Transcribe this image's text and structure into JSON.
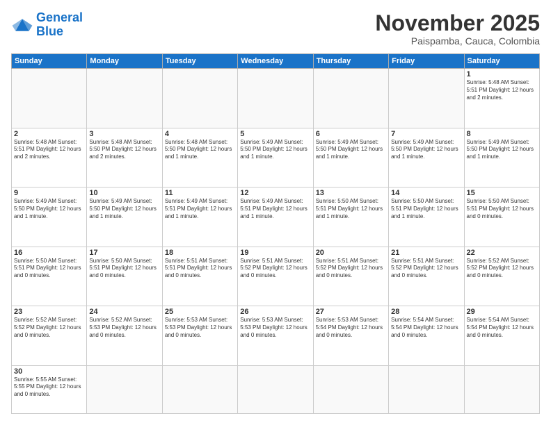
{
  "logo": {
    "line1": "General",
    "line2": "Blue"
  },
  "title": "November 2025",
  "subtitle": "Paispamba, Cauca, Colombia",
  "weekdays": [
    "Sunday",
    "Monday",
    "Tuesday",
    "Wednesday",
    "Thursday",
    "Friday",
    "Saturday"
  ],
  "weeks": [
    [
      {
        "day": "",
        "info": ""
      },
      {
        "day": "",
        "info": ""
      },
      {
        "day": "",
        "info": ""
      },
      {
        "day": "",
        "info": ""
      },
      {
        "day": "",
        "info": ""
      },
      {
        "day": "",
        "info": ""
      },
      {
        "day": "1",
        "info": "Sunrise: 5:48 AM\nSunset: 5:51 PM\nDaylight: 12 hours\nand 2 minutes."
      }
    ],
    [
      {
        "day": "2",
        "info": "Sunrise: 5:48 AM\nSunset: 5:51 PM\nDaylight: 12 hours\nand 2 minutes."
      },
      {
        "day": "3",
        "info": "Sunrise: 5:48 AM\nSunset: 5:50 PM\nDaylight: 12 hours\nand 2 minutes."
      },
      {
        "day": "4",
        "info": "Sunrise: 5:48 AM\nSunset: 5:50 PM\nDaylight: 12 hours\nand 1 minute."
      },
      {
        "day": "5",
        "info": "Sunrise: 5:49 AM\nSunset: 5:50 PM\nDaylight: 12 hours\nand 1 minute."
      },
      {
        "day": "6",
        "info": "Sunrise: 5:49 AM\nSunset: 5:50 PM\nDaylight: 12 hours\nand 1 minute."
      },
      {
        "day": "7",
        "info": "Sunrise: 5:49 AM\nSunset: 5:50 PM\nDaylight: 12 hours\nand 1 minute."
      },
      {
        "day": "8",
        "info": "Sunrise: 5:49 AM\nSunset: 5:50 PM\nDaylight: 12 hours\nand 1 minute."
      }
    ],
    [
      {
        "day": "9",
        "info": "Sunrise: 5:49 AM\nSunset: 5:50 PM\nDaylight: 12 hours\nand 1 minute."
      },
      {
        "day": "10",
        "info": "Sunrise: 5:49 AM\nSunset: 5:50 PM\nDaylight: 12 hours\nand 1 minute."
      },
      {
        "day": "11",
        "info": "Sunrise: 5:49 AM\nSunset: 5:51 PM\nDaylight: 12 hours\nand 1 minute."
      },
      {
        "day": "12",
        "info": "Sunrise: 5:49 AM\nSunset: 5:51 PM\nDaylight: 12 hours\nand 1 minute."
      },
      {
        "day": "13",
        "info": "Sunrise: 5:50 AM\nSunset: 5:51 PM\nDaylight: 12 hours\nand 1 minute."
      },
      {
        "day": "14",
        "info": "Sunrise: 5:50 AM\nSunset: 5:51 PM\nDaylight: 12 hours\nand 1 minute."
      },
      {
        "day": "15",
        "info": "Sunrise: 5:50 AM\nSunset: 5:51 PM\nDaylight: 12 hours\nand 0 minutes."
      }
    ],
    [
      {
        "day": "16",
        "info": "Sunrise: 5:50 AM\nSunset: 5:51 PM\nDaylight: 12 hours\nand 0 minutes."
      },
      {
        "day": "17",
        "info": "Sunrise: 5:50 AM\nSunset: 5:51 PM\nDaylight: 12 hours\nand 0 minutes."
      },
      {
        "day": "18",
        "info": "Sunrise: 5:51 AM\nSunset: 5:51 PM\nDaylight: 12 hours\nand 0 minutes."
      },
      {
        "day": "19",
        "info": "Sunrise: 5:51 AM\nSunset: 5:52 PM\nDaylight: 12 hours\nand 0 minutes."
      },
      {
        "day": "20",
        "info": "Sunrise: 5:51 AM\nSunset: 5:52 PM\nDaylight: 12 hours\nand 0 minutes."
      },
      {
        "day": "21",
        "info": "Sunrise: 5:51 AM\nSunset: 5:52 PM\nDaylight: 12 hours\nand 0 minutes."
      },
      {
        "day": "22",
        "info": "Sunrise: 5:52 AM\nSunset: 5:52 PM\nDaylight: 12 hours\nand 0 minutes."
      }
    ],
    [
      {
        "day": "23",
        "info": "Sunrise: 5:52 AM\nSunset: 5:52 PM\nDaylight: 12 hours\nand 0 minutes."
      },
      {
        "day": "24",
        "info": "Sunrise: 5:52 AM\nSunset: 5:53 PM\nDaylight: 12 hours\nand 0 minutes."
      },
      {
        "day": "25",
        "info": "Sunrise: 5:53 AM\nSunset: 5:53 PM\nDaylight: 12 hours\nand 0 minutes."
      },
      {
        "day": "26",
        "info": "Sunrise: 5:53 AM\nSunset: 5:53 PM\nDaylight: 12 hours\nand 0 minutes."
      },
      {
        "day": "27",
        "info": "Sunrise: 5:53 AM\nSunset: 5:54 PM\nDaylight: 12 hours\nand 0 minutes."
      },
      {
        "day": "28",
        "info": "Sunrise: 5:54 AM\nSunset: 5:54 PM\nDaylight: 12 hours\nand 0 minutes."
      },
      {
        "day": "29",
        "info": "Sunrise: 5:54 AM\nSunset: 5:54 PM\nDaylight: 12 hours\nand 0 minutes."
      }
    ],
    [
      {
        "day": "30",
        "info": "Sunrise: 5:55 AM\nSunset: 5:55 PM\nDaylight: 12 hours\nand 0 minutes."
      },
      {
        "day": "",
        "info": ""
      },
      {
        "day": "",
        "info": ""
      },
      {
        "day": "",
        "info": ""
      },
      {
        "day": "",
        "info": ""
      },
      {
        "day": "",
        "info": ""
      },
      {
        "day": "",
        "info": ""
      }
    ]
  ]
}
